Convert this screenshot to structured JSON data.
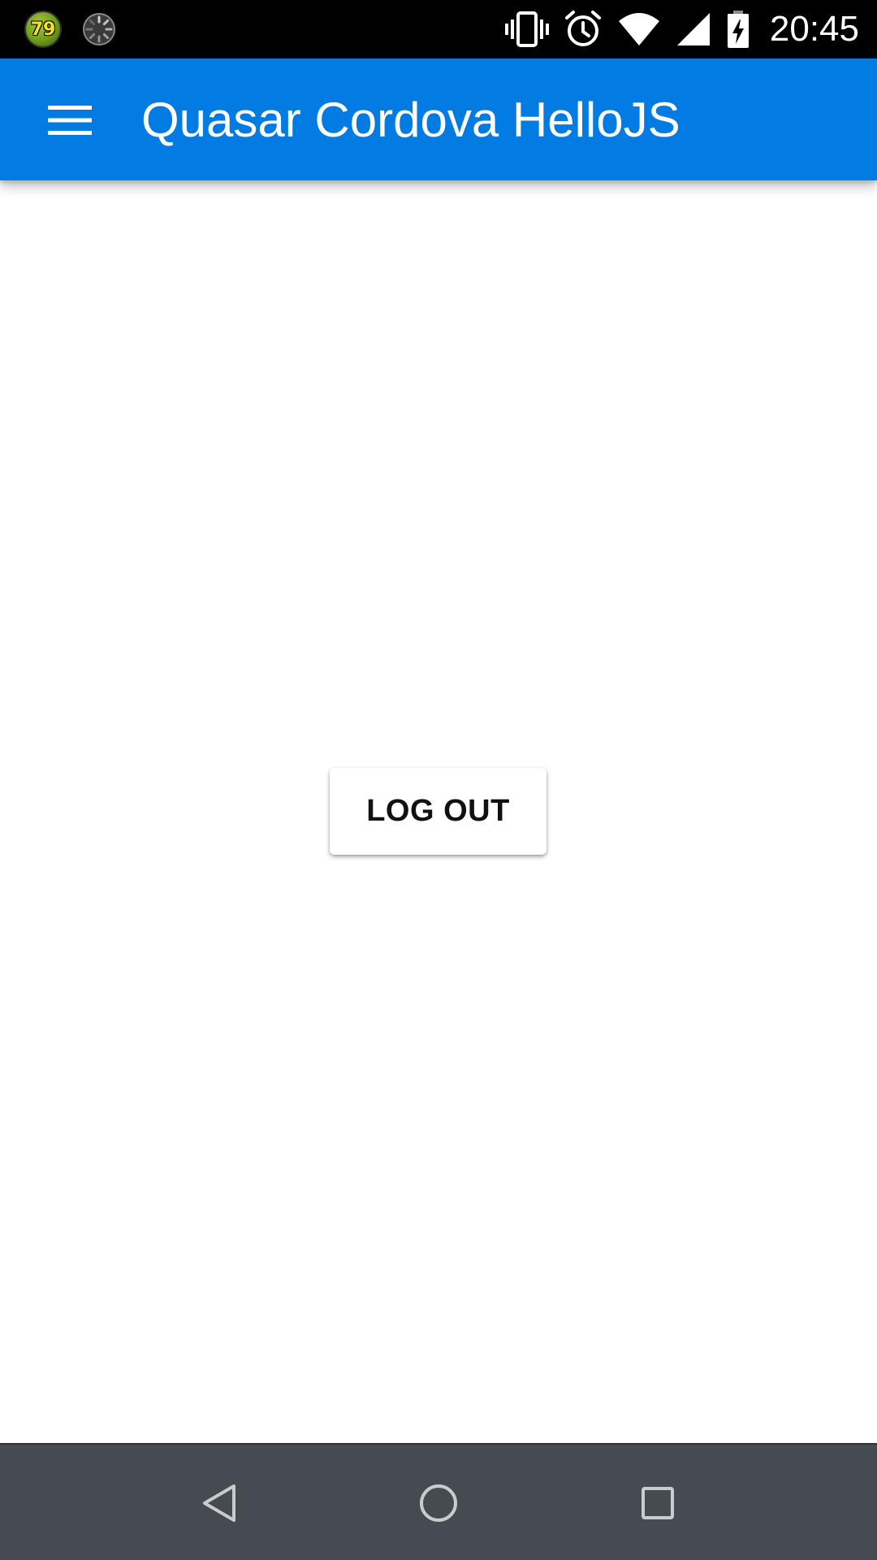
{
  "status_bar": {
    "notification_badge": "79",
    "time": "20:45",
    "icons": [
      "badge-icon",
      "spinner-icon",
      "vibrate-icon",
      "alarm-icon",
      "wifi-icon",
      "cell-signal-icon",
      "battery-charging-icon"
    ]
  },
  "header": {
    "title": "Quasar Cordova HelloJS",
    "menu_icon": "menu-icon",
    "color": "#027be3"
  },
  "main": {
    "logout_label": "LOG OUT"
  },
  "nav_bar": {
    "back_icon": "back-icon",
    "home_icon": "home-icon",
    "recents_icon": "recents-icon",
    "color": "#454b50"
  }
}
